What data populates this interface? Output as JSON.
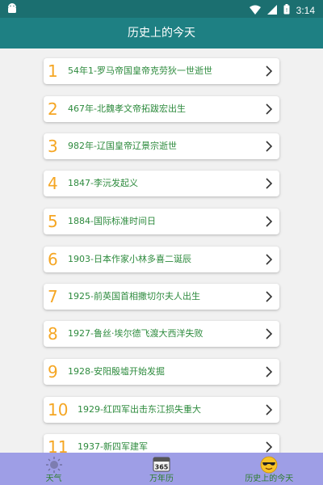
{
  "status_bar": {
    "time": "3:14"
  },
  "app_bar": {
    "title": "历史上的今天"
  },
  "events": [
    {
      "num": "1",
      "text": "54年1-罗马帝国皇帝克劳狄一世逝世"
    },
    {
      "num": "2",
      "text": "467年-北魏孝文帝拓跋宏出生"
    },
    {
      "num": "3",
      "text": "982年-辽国皇帝辽景宗逝世"
    },
    {
      "num": "4",
      "text": "1847-李沅发起义"
    },
    {
      "num": "5",
      "text": "1884-国际标准时间日"
    },
    {
      "num": "6",
      "text": "1903-日本作家小林多喜二诞辰"
    },
    {
      "num": "7",
      "text": "1925-前英国首相撒切尔夫人出生"
    },
    {
      "num": "8",
      "text": "1927-鲁丝·埃尔德飞渡大西洋失败"
    },
    {
      "num": "9",
      "text": "1928-安阳殷墟开始发掘"
    },
    {
      "num": "10",
      "text": "1929-红四军出击东江损失重大"
    },
    {
      "num": "11",
      "text": "1937-新四军建军"
    }
  ],
  "bottom_nav": {
    "tabs": [
      {
        "label": "天气",
        "icon": "weather-icon"
      },
      {
        "label": "万年历",
        "icon": "calendar-icon",
        "icon_text": "365"
      },
      {
        "label": "历史上的今天",
        "icon": "sunglasses-emoji-icon"
      }
    ]
  },
  "colors": {
    "status_bar": "#1b6f70",
    "app_bar": "#1e8083",
    "number": "#f5a623",
    "event_text": "#2e8b3e",
    "bottom_nav": "#9e9ee6"
  }
}
